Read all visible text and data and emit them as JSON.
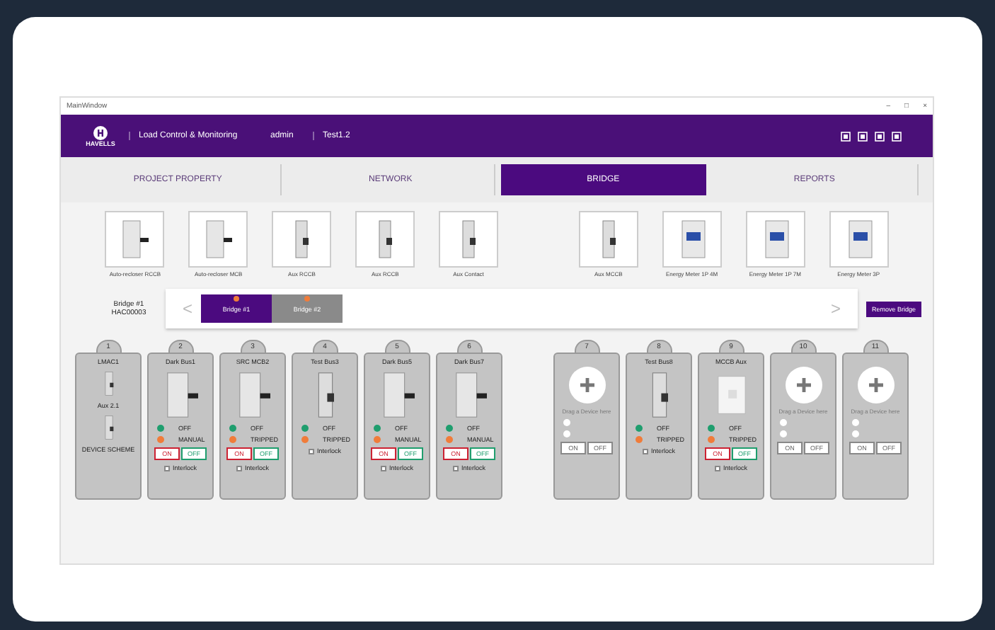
{
  "window": {
    "title": "MainWindow",
    "controls": [
      "–",
      "□",
      "×"
    ]
  },
  "header": {
    "logo": "HAVELLS",
    "app": "Load Control & Monitoring",
    "user": "admin",
    "project": "Test1.2"
  },
  "tabs": [
    {
      "label": "PROJECT PROPERTY",
      "selected": false
    },
    {
      "label": "NETWORK",
      "selected": false
    },
    {
      "label": "BRIDGE",
      "selected": true
    },
    {
      "label": "REPORTS",
      "selected": false
    }
  ],
  "palette": [
    {
      "label": "Auto-recloser RCCB",
      "kind": "breaker"
    },
    {
      "label": "Auto-recloser MCB",
      "kind": "breaker"
    },
    {
      "label": "Aux RCCB",
      "kind": "aux"
    },
    {
      "label": "Aux RCCB",
      "kind": "aux"
    },
    {
      "label": "Aux Contact",
      "kind": "aux"
    },
    {
      "label": "Aux MCCB",
      "kind": "aux"
    },
    {
      "label": "Energy Meter 1P 4M",
      "kind": "meter"
    },
    {
      "label": "Energy Meter 1P 7M",
      "kind": "meter"
    },
    {
      "label": "Energy Meter 3P",
      "kind": "meter"
    }
  ],
  "bridge": {
    "label": "Bridge #1",
    "id": "HAC00003",
    "prev": "<",
    "next": ">",
    "tabs": [
      {
        "label": "Bridge #1",
        "selected": true
      },
      {
        "label": "Bridge #2",
        "selected": false
      }
    ],
    "remove": "Remove Bridge"
  },
  "slots": [
    {
      "number": "1",
      "kind": "aux",
      "items": [
        "LMAC1",
        "Aux 2.1"
      ],
      "footer": "DEVICE SCHEME"
    },
    {
      "number": "2",
      "kind": "device",
      "title": "Dark Bus1",
      "device": {
        "kind": "breaker"
      },
      "states": [
        {
          "label": "OFF",
          "color": "#1f9e6e"
        },
        {
          "label": "MANUAL",
          "color": "#f07c3a"
        }
      ],
      "buttons": [
        "ON",
        "OFF"
      ],
      "option": {
        "label": "Interlock",
        "checked": false
      }
    },
    {
      "number": "3",
      "kind": "device",
      "title": "SRC MCB2",
      "device": {
        "kind": "breaker"
      },
      "states": [
        {
          "label": "OFF",
          "color": "#1f9e6e"
        },
        {
          "label": "TRIPPED",
          "color": "#f07c3a"
        }
      ],
      "buttons": [
        "ON",
        "OFF"
      ],
      "option": {
        "label": "Interlock",
        "checked": false
      }
    },
    {
      "number": "4",
      "kind": "device",
      "title": "Test Bus3",
      "device": {
        "kind": "aux"
      },
      "states": [
        {
          "label": "OFF",
          "color": "#1f9e6e"
        },
        {
          "label": "TRIPPED",
          "color": "#f07c3a"
        }
      ],
      "option": {
        "label": "Interlock",
        "checked": false
      }
    },
    {
      "number": "5",
      "kind": "device",
      "title": "Dark Bus5",
      "device": {
        "kind": "breaker"
      },
      "states": [
        {
          "label": "OFF",
          "color": "#1f9e6e"
        },
        {
          "label": "MANUAL",
          "color": "#f07c3a"
        }
      ],
      "buttons": [
        "ON",
        "OFF"
      ],
      "option": {
        "label": "Interlock",
        "checked": false
      }
    },
    {
      "number": "6",
      "kind": "device",
      "title": "Dark Bus7",
      "device": {
        "kind": "breaker"
      },
      "states": [
        {
          "label": "OFF",
          "color": "#1f9e6e"
        },
        {
          "label": "MANUAL",
          "color": "#f07c3a"
        }
      ],
      "buttons": [
        "ON",
        "OFF"
      ],
      "option": {
        "label": "Interlock",
        "checked": false
      }
    },
    {
      "number": "7",
      "kind": "empty",
      "hint": "Drag a Device here",
      "radios": [
        {
          "selected": false
        },
        {
          "selected": false
        }
      ],
      "buttons": [
        "ON",
        "OFF"
      ]
    },
    {
      "number": "8",
      "kind": "device",
      "title": "Test Bus8",
      "device": {
        "kind": "aux"
      },
      "states": [
        {
          "label": "OFF",
          "color": "#1f9e6e"
        },
        {
          "label": "TRIPPED",
          "color": "#f07c3a"
        }
      ],
      "option": {
        "label": "Interlock",
        "checked": false
      }
    },
    {
      "number": "9",
      "kind": "device",
      "title": "MCCB Aux",
      "device": {
        "kind": "mccb"
      },
      "states": [
        {
          "label": "OFF",
          "color": "#1f9e6e"
        },
        {
          "label": "TRIPPED",
          "color": "#f07c3a"
        }
      ],
      "buttons": [
        "ON",
        "OFF"
      ],
      "option": {
        "label": "Interlock",
        "checked": false
      }
    },
    {
      "number": "10",
      "kind": "empty",
      "hint": "Drag a Device here",
      "radios": [
        {
          "selected": false
        },
        {
          "selected": false
        }
      ],
      "buttons": [
        "ON",
        "OFF"
      ]
    },
    {
      "number": "11",
      "kind": "empty",
      "hint": "Drag a Device here",
      "radios": [
        {
          "selected": false
        },
        {
          "selected": false
        }
      ],
      "buttons": [
        "ON",
        "OFF"
      ]
    }
  ]
}
